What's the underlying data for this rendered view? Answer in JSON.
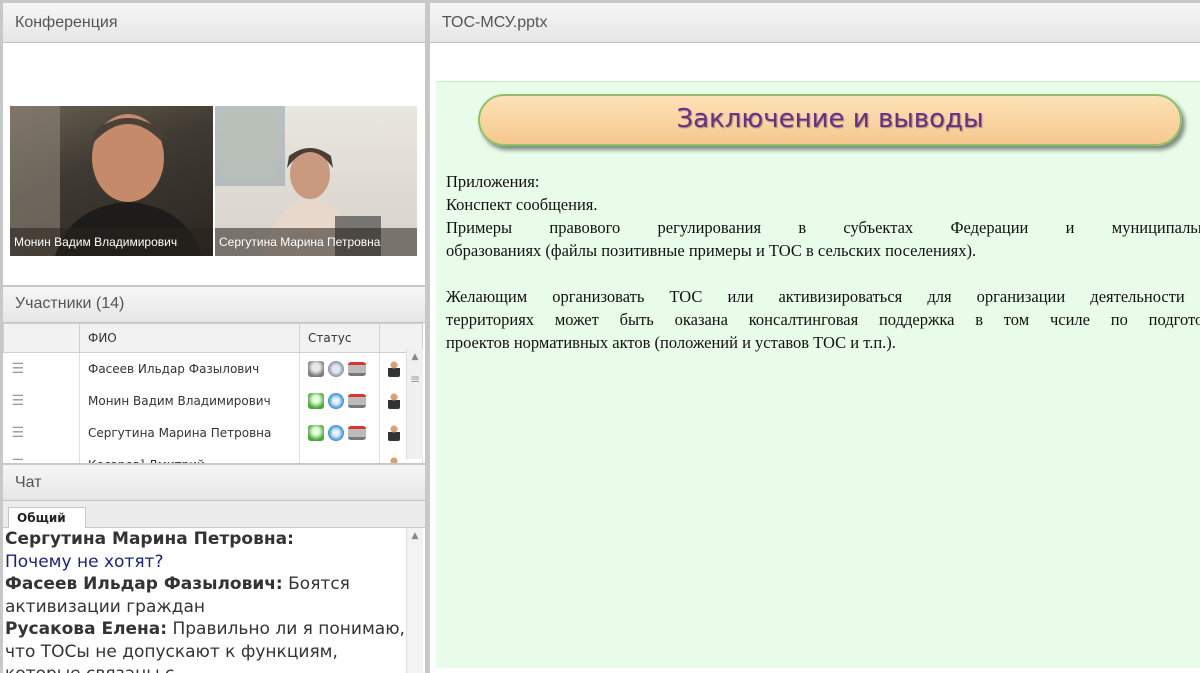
{
  "conference": {
    "title": "Конференция",
    "videos": [
      {
        "name": "Монин Вадим Владимирович"
      },
      {
        "name": "Сергутина Марина Петровна"
      }
    ]
  },
  "participants": {
    "title": "Участники (14)",
    "columns": {
      "name": "ФИО",
      "status": "Статус"
    },
    "rows": [
      {
        "name": "Фасеев Ильдар Фазылович"
      },
      {
        "name": "Монин Вадим Владимирович"
      },
      {
        "name": "Сергутина Марина Петровна"
      },
      {
        "name": "Кесарев] Дмитрий"
      }
    ]
  },
  "chat": {
    "title": "Чат",
    "tab": "Общий",
    "messages": [
      {
        "author": "Сергутина Марина Петровна:",
        "text": "Почему не хотят?"
      },
      {
        "author": "Фасеев Ильдар Фазылович:",
        "text": "Боятся активизации граждан"
      },
      {
        "author": "Русакова Елена:",
        "text": "Правильно ли я понимаю, что ТОСы не допускают к функциям, которые связаны с"
      }
    ]
  },
  "presentation": {
    "filename": "ТОС-МСУ.pptx",
    "slide_title": "Заключение и выводы",
    "lines": {
      "l1": "Приложения:",
      "l2": "Конспект сообщения.",
      "l3": "Примеры правового регулирования в субъектах Федерации и муниципальных",
      "l4": "образованиях (файлы позитивные примеры и ТОС в сельских поселениях).",
      "l5": "Желающим организовать ТОС или активизироваться для организации деятельности на",
      "l6": "территориях может быть оказана консалтинговая поддержка в том чсиле  по подготовке",
      "l7": "проектов нормативных актов (положений и уставов ТОС и т.п.)."
    }
  }
}
